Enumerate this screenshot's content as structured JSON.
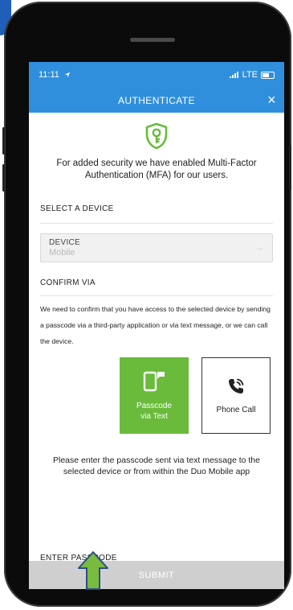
{
  "status_bar": {
    "time": "11:11",
    "network": "LTE"
  },
  "header": {
    "title": "AUTHENTICATE",
    "close_icon": "×"
  },
  "intro_text": "For added security we have enabled Multi-Factor Authentication (MFA) for our users.",
  "select_device": {
    "section_label": "SELECT A DEVICE",
    "field_label": "DEVICE",
    "field_value": "Mobile"
  },
  "confirm_via": {
    "section_label": "CONFIRM VIA",
    "description": "We need to confirm that you have access to the selected device by sending a passcode via a third-party application or via text message, or we can call the device.",
    "options": [
      {
        "line1": "Passcode",
        "line2": "via Text",
        "selected": true
      },
      {
        "label": "Phone Call",
        "selected": false
      }
    ]
  },
  "note": "Please enter the passcode sent via text message to the selected device or from within the Duo Mobile app",
  "passcode": {
    "section_label": "ENTER PASSCODE"
  },
  "submit_label": "SUBMIT",
  "colors": {
    "header": "#2f8fdc",
    "accent_green": "#6abb3c",
    "submit_disabled": "#cfcfcf"
  }
}
